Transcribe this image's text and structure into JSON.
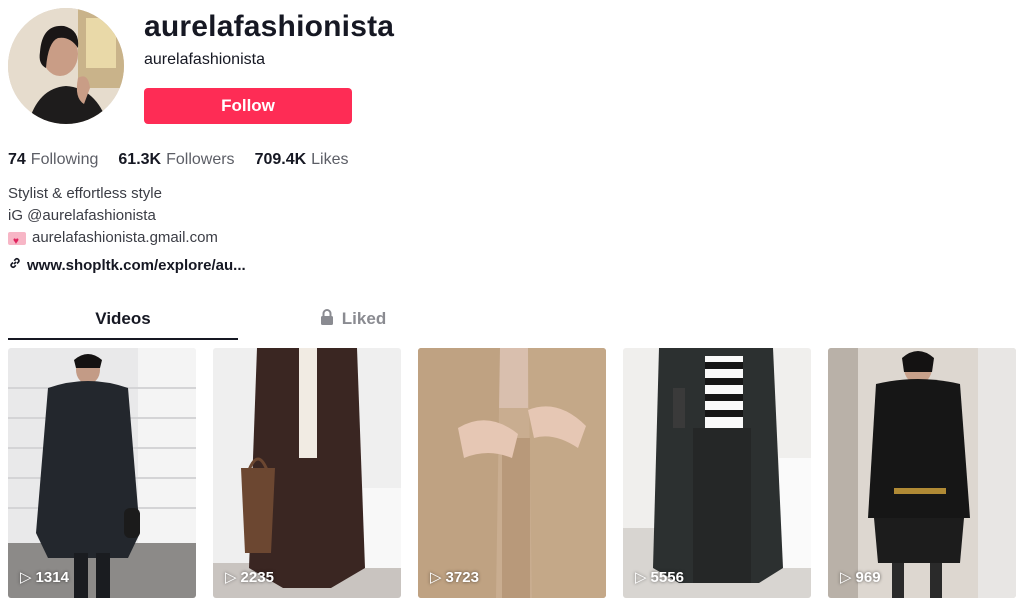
{
  "profile": {
    "username": "aurelafashionista",
    "nickname": "aurelafashionista",
    "follow_label": "Follow"
  },
  "stats": [
    {
      "value": "74",
      "label": "Following"
    },
    {
      "value": "61.3K",
      "label": "Followers"
    },
    {
      "value": "709.4K",
      "label": "Likes"
    }
  ],
  "bio": {
    "line1": "Stylist & effortless style",
    "line2": "iG @aurelafashionista",
    "line3": "aurelafashionista.gmail.com",
    "link": "www.shopltk.com/explore/au..."
  },
  "tabs": {
    "videos": "Videos",
    "liked": "Liked"
  },
  "videos": [
    {
      "views": "1314"
    },
    {
      "views": "2235"
    },
    {
      "views": "3723"
    },
    {
      "views": "5556"
    },
    {
      "views": "969"
    }
  ],
  "colors": {
    "accent": "#fe2c55",
    "text": "#161823"
  }
}
